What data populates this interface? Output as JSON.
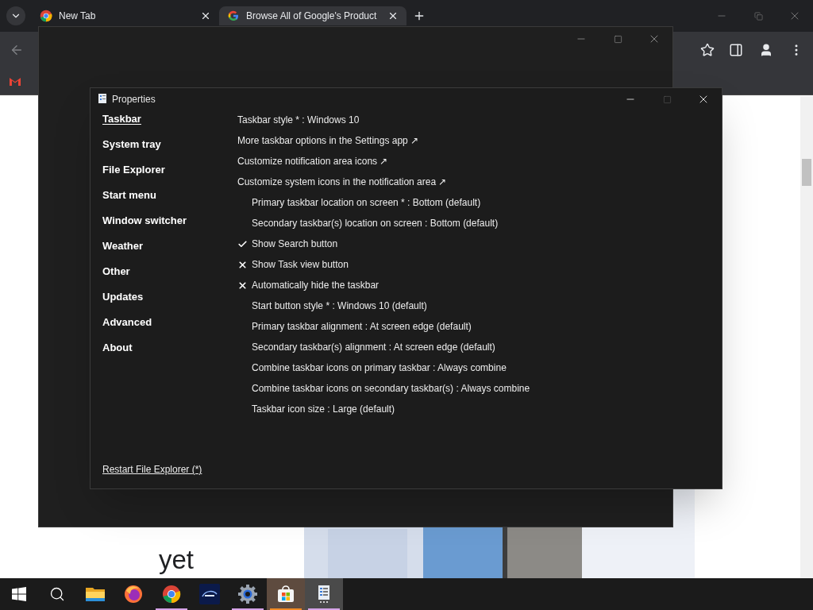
{
  "browser": {
    "tabs": [
      {
        "title": "New Tab",
        "selected": false
      },
      {
        "title": "Browse All of Google's Product",
        "selected": true
      }
    ],
    "page": {
      "heading": "yet",
      "kind": "picture"
    }
  },
  "properties": {
    "title": "Properties",
    "sidebar": [
      {
        "label": "Taskbar",
        "selected": true
      },
      {
        "label": "System tray",
        "selected": false
      },
      {
        "label": "File Explorer",
        "selected": false
      },
      {
        "label": "Start menu",
        "selected": false
      },
      {
        "label": "Window switcher",
        "selected": false
      },
      {
        "label": "Weather",
        "selected": false
      },
      {
        "label": "Other",
        "selected": false
      },
      {
        "label": "Updates",
        "selected": false
      },
      {
        "label": "Advanced",
        "selected": false
      },
      {
        "label": "About",
        "selected": false
      }
    ],
    "settings": [
      {
        "kind": "main",
        "text": "Taskbar style * : Windows 10"
      },
      {
        "kind": "main",
        "text": "More taskbar options in the Settings app ↗"
      },
      {
        "kind": "main",
        "text": "Customize notification area icons ↗"
      },
      {
        "kind": "main",
        "text": "Customize system icons in the notification area ↗"
      },
      {
        "kind": "sub",
        "text": "Primary taskbar location on screen * : Bottom (default)"
      },
      {
        "kind": "sub",
        "text": "Secondary taskbar(s) location on screen : Bottom (default)"
      },
      {
        "kind": "toggle",
        "text": "Show Search button",
        "checked": true
      },
      {
        "kind": "toggle",
        "text": "Show Task view button",
        "checked": false
      },
      {
        "kind": "toggle",
        "text": "Automatically hide the taskbar",
        "checked": false
      },
      {
        "kind": "sub",
        "text": "Start button style * : Windows 10 (default)"
      },
      {
        "kind": "sub",
        "text": "Primary taskbar alignment : At screen edge (default)"
      },
      {
        "kind": "sub",
        "text": "Secondary taskbar(s) alignment : At screen edge (default)"
      },
      {
        "kind": "sub",
        "text": "Combine taskbar icons on primary taskbar : Always combine"
      },
      {
        "kind": "sub",
        "text": "Combine taskbar icons on secondary taskbar(s) : Always combine"
      },
      {
        "kind": "sub",
        "text": "Taskbar icon size : Large (default)"
      }
    ],
    "footer_link": "Restart File Explorer (*)"
  },
  "taskbar": {
    "items": [
      {
        "kind": "start",
        "selected": false,
        "hovered": false
      },
      {
        "kind": "search",
        "selected": false,
        "hovered": false
      },
      {
        "kind": "folder",
        "selected": false,
        "hovered": false
      },
      {
        "kind": "firefox",
        "selected": false,
        "hovered": false
      },
      {
        "kind": "chrome",
        "selected": false,
        "hovered": false,
        "color": "#d6a4e8"
      },
      {
        "kind": "disney",
        "selected": false,
        "hovered": false
      },
      {
        "kind": "settings",
        "selected": false,
        "hovered": false,
        "color": "#d6a4e8"
      },
      {
        "kind": "store",
        "selected": false,
        "hovered": true,
        "color": "#f08a24"
      },
      {
        "kind": "app",
        "selected": true,
        "hovered": false,
        "color": "#d6a4e8"
      }
    ]
  }
}
